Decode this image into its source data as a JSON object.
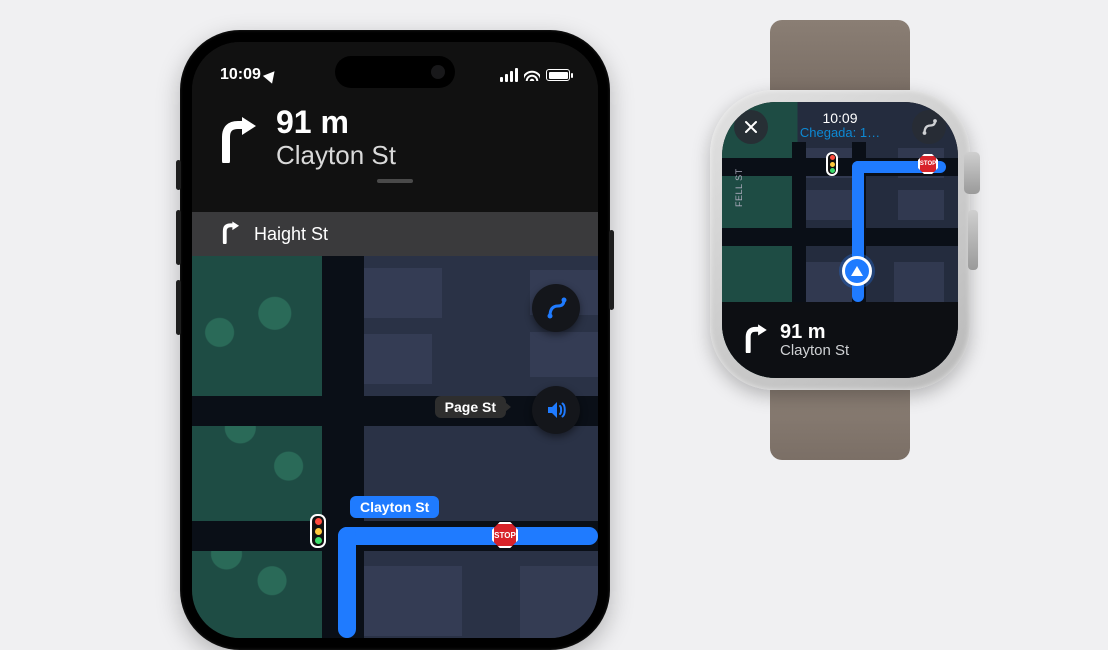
{
  "phone": {
    "status": {
      "time": "10:09"
    },
    "direction": {
      "distance": "91 m",
      "street": "Clayton St"
    },
    "nextStep": {
      "street": "Haight St"
    },
    "map": {
      "claytonLabel": "Clayton St",
      "pageLabel": "Page St",
      "stopText": "STOP"
    }
  },
  "watch": {
    "status": {
      "time": "10:09",
      "subtitle": "Chegada: 1…"
    },
    "map": {
      "fellLabel": "FELL ST",
      "stopText": "STOP"
    },
    "direction": {
      "distance": "91 m",
      "street": "Clayton St"
    }
  }
}
